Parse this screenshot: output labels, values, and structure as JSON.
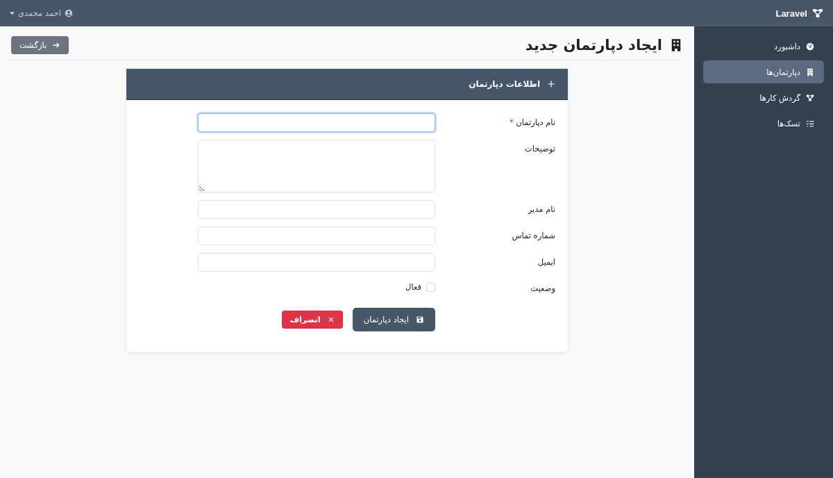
{
  "topbar": {
    "brand": "Laravel",
    "user": "احمد محمدی"
  },
  "sidebar": {
    "items": [
      {
        "label": "داشبورد",
        "selected": false
      },
      {
        "label": "دپارتمان‌ها",
        "selected": true
      },
      {
        "label": "گردش کارها",
        "selected": false
      },
      {
        "label": "تسک‌ها",
        "selected": false
      }
    ]
  },
  "page": {
    "title": "ایجاد دپارتمان جدید",
    "back_button": "بازگشت"
  },
  "card": {
    "title": "اطلاعات دپارتمان",
    "fields": [
      {
        "kind": "input",
        "label": "نام دپارتمان",
        "required_mark": "*",
        "focused": true
      },
      {
        "kind": "textarea",
        "label": "توضیحات",
        "focused": false
      },
      {
        "kind": "input",
        "label": "نام مدیر",
        "focused": false
      },
      {
        "kind": "input",
        "label": "شماره تماس",
        "focused": false
      },
      {
        "kind": "input",
        "label": "ایمیل",
        "focused": false
      },
      {
        "kind": "checkbox",
        "label": "وضعیت",
        "option": "فعال",
        "checked": false
      }
    ],
    "submit_button": "ایجاد دپارتمان",
    "cancel_button": "انصراف"
  }
}
